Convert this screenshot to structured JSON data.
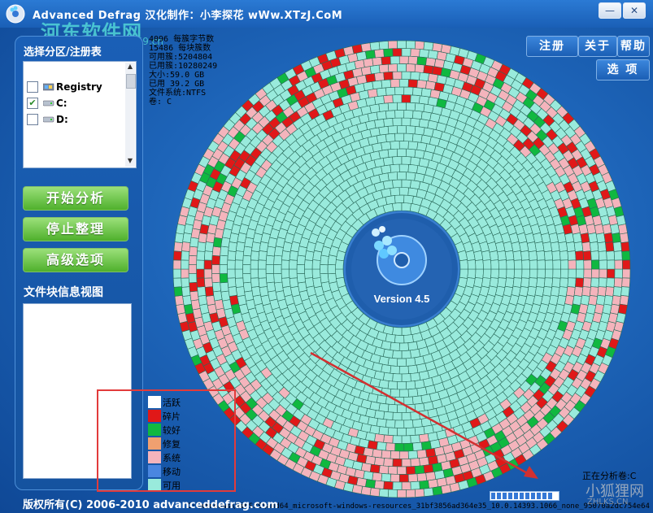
{
  "window": {
    "title": "Advanced Defrag   汉化制作：小李探花 wWw.XTzJ.CoM",
    "minimize_label": "—",
    "close_label": "✕"
  },
  "topbar": {
    "register": "注册",
    "about": "关于",
    "help": "帮助",
    "options": "选 项"
  },
  "left_panel": {
    "select_heading": "选择分区/注册表",
    "drives": [
      {
        "label": "Registry",
        "checked": false
      },
      {
        "label": "C:",
        "checked": true
      },
      {
        "label": "D:",
        "checked": false
      }
    ],
    "buttons": {
      "analyze": "开始分析",
      "stop": "停止整理",
      "advanced": "高级选项"
    },
    "info_heading": "文件块信息视图"
  },
  "stats": {
    "line1": "4096 每簇字节数",
    "line2": "15486 每块簇数",
    "line3": "可用簇:5204804",
    "line4": "已用簇:10280249",
    "line5": "大小:59.0 GB",
    "line6": "已用 39.2 GB",
    "line7": "文件系统:NTFS",
    "line8": "卷:  C"
  },
  "disk": {
    "version": "Version 4.5",
    "colors": {
      "free": "#99eadc",
      "fragmented": "#e01818",
      "good": "#10b840",
      "system": "#f4b4bc",
      "grid": "#2a6a5a"
    }
  },
  "legend": [
    {
      "label": "活跃",
      "color": "#ffffff"
    },
    {
      "label": "碎片",
      "color": "#e01818"
    },
    {
      "label": "较好",
      "color": "#10b840"
    },
    {
      "label": "修复",
      "color": "#f0a070"
    },
    {
      "label": "系统",
      "color": "#f4b4bc"
    },
    {
      "label": "移动",
      "color": "#4a86e0"
    },
    {
      "label": "可用",
      "color": "#99eadc"
    }
  ],
  "status": {
    "analyzing": "正在分析卷:C",
    "path": "C:\\Windows\\WinSxS\\amd64_microsoft-windows-resources_31bf3856ad364e35_10.0.14393.1066_none_95070a2dc754e64"
  },
  "footer": "版权所有(C) 2006-2010 advanceddefrag.com",
  "watermark": {
    "top": "河东软件网",
    "top_sub": "www.pc0359.cn",
    "bottom": "小狐狸网",
    "bottom_sub": "ZHLKS.CN"
  }
}
